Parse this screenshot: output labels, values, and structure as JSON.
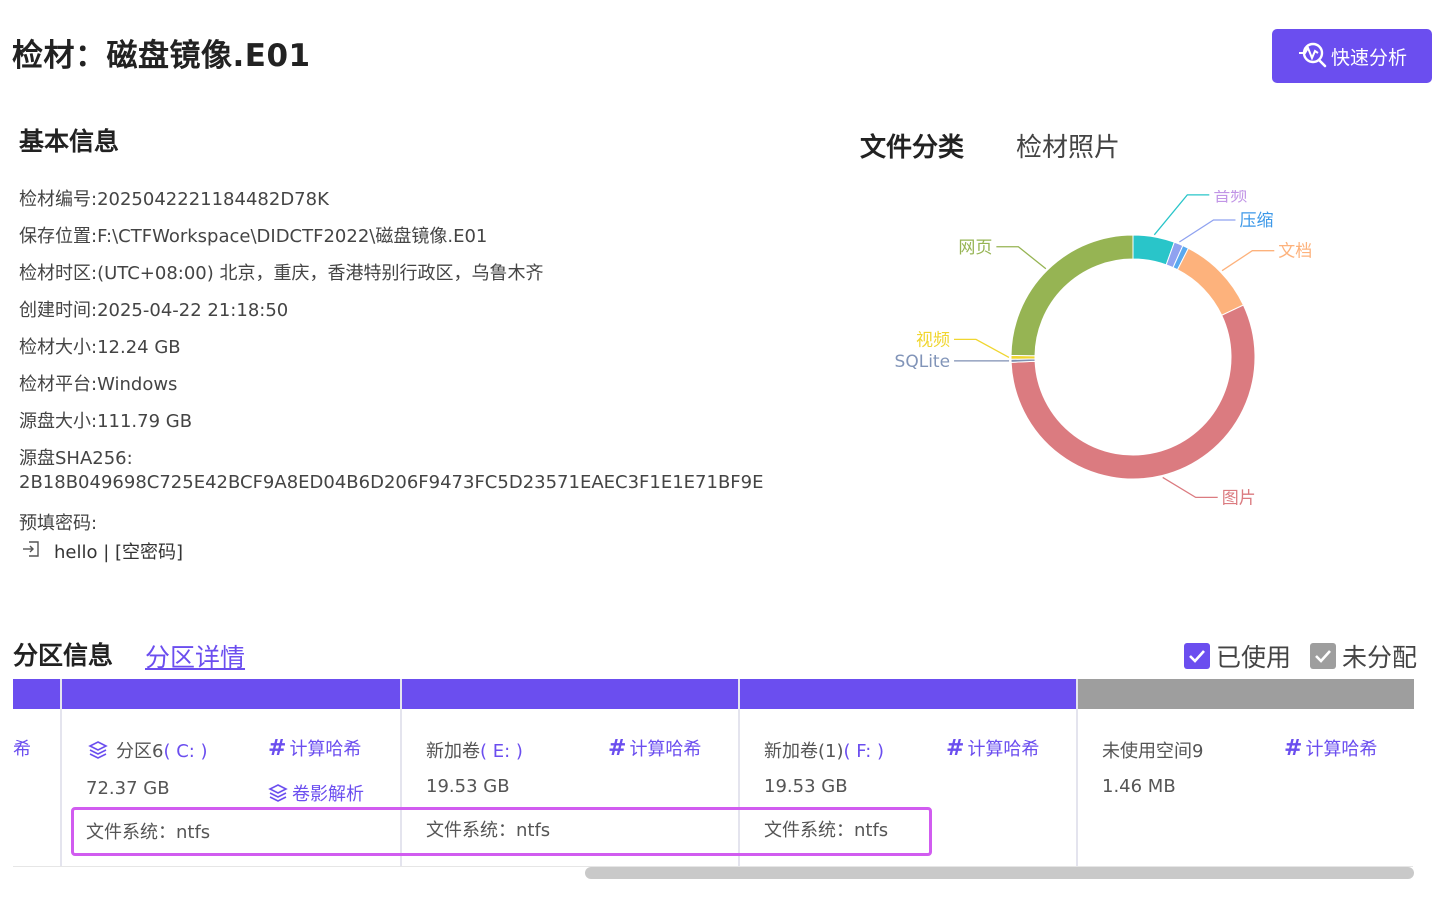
{
  "header": {
    "title": "检材：磁盘镜像.E01",
    "quick_analyze_label": "快速分析"
  },
  "basic_info": {
    "heading": "基本信息",
    "rows": [
      {
        "key": "检材编号:",
        "value": "2025042221184482D78K"
      },
      {
        "key": "保存位置:",
        "value": "F:\\CTFWorkspace\\DIDCTF2022\\磁盘镜像.E01"
      },
      {
        "key": "检材时区:",
        "value": "(UTC+08:00) 北京，重庆，香港特别行政区，乌鲁木齐"
      },
      {
        "key": "创建时间:",
        "value": "2025-04-22 21:18:50"
      },
      {
        "key": "检材大小:",
        "value": "12.24 GB"
      },
      {
        "key": "检材平台:",
        "value": "Windows"
      },
      {
        "key": "源盘大小:",
        "value": "111.79 GB"
      }
    ],
    "sha_label": "源盘SHA256:",
    "sha_value": "2B18B049698C725E42BCF9A8ED04B6D206F9473FC5D23571EAEC3F1E1E71BF9E",
    "password_label": "预填密码:",
    "password_value": "hello | [空密码]"
  },
  "file_tabs": {
    "active": "文件分类",
    "inactive": "检材照片"
  },
  "chart_data": {
    "type": "pie",
    "donut": true,
    "legend": "none",
    "slices": [
      {
        "label": "音频",
        "value": 5.5,
        "color": "#29c5c9"
      },
      {
        "label": "压缩",
        "value": 1.2,
        "color": "#8fa2f0"
      },
      {
        "label": "",
        "value": 0.8,
        "color": "#5aa9ef"
      },
      {
        "label": "文档",
        "value": 10.5,
        "color": "#fdb27c"
      },
      {
        "label": "图片",
        "value": 56.3,
        "color": "#db7b80"
      },
      {
        "label": "SQLite",
        "value": 0.4,
        "color": "#7f8fb3"
      },
      {
        "label": "视频",
        "value": 0.5,
        "color": "#f0d630"
      },
      {
        "label": "网页",
        "value": 24.8,
        "color": "#96b453"
      }
    ],
    "label_colors": {
      "音频": "#c195e6",
      "压缩": "#3c98e8",
      "文档": "#fdb27c",
      "图片": "#db7b80",
      "SQLite": "#8194b8",
      "视频": "#f0d630",
      "网页": "#96b453"
    }
  },
  "partitions": {
    "heading": "分区信息",
    "detail_link": "分区详情",
    "legend_used": "已使用",
    "legend_unalloc": "未分配",
    "colors": {
      "used": "#6b4eef",
      "unalloc": "#9e9e9e",
      "accent": "#6b4eef"
    },
    "left_fragment": "希",
    "hash_label": "计算哈希",
    "shadow_label": "卷影解析",
    "cells": [
      {
        "name": "分区6",
        "drive": "( C: )",
        "size": "72.37 GB",
        "fs": "文件系统：ntfs"
      },
      {
        "name": "新加卷",
        "drive": "( E: )",
        "size": "19.53 GB",
        "fs": "文件系统：ntfs"
      },
      {
        "name": "新加卷(1)",
        "drive": "( F: )",
        "size": "19.53 GB",
        "fs": "文件系统：ntfs"
      },
      {
        "name": "未使用空间9",
        "drive": "",
        "size": "1.46 MB",
        "fs": ""
      }
    ]
  }
}
